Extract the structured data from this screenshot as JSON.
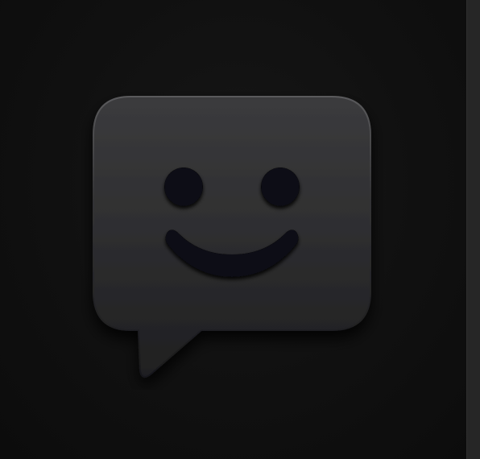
{
  "app_icon": {
    "icon_name": "smiley-chat-bubble-icon",
    "colors": {
      "page_background": "#0f0f0f",
      "side_strip": "#262626",
      "bubble_top": "#3a3a3c",
      "bubble_bottom": "#222224",
      "face_cutout": "#101010"
    }
  }
}
